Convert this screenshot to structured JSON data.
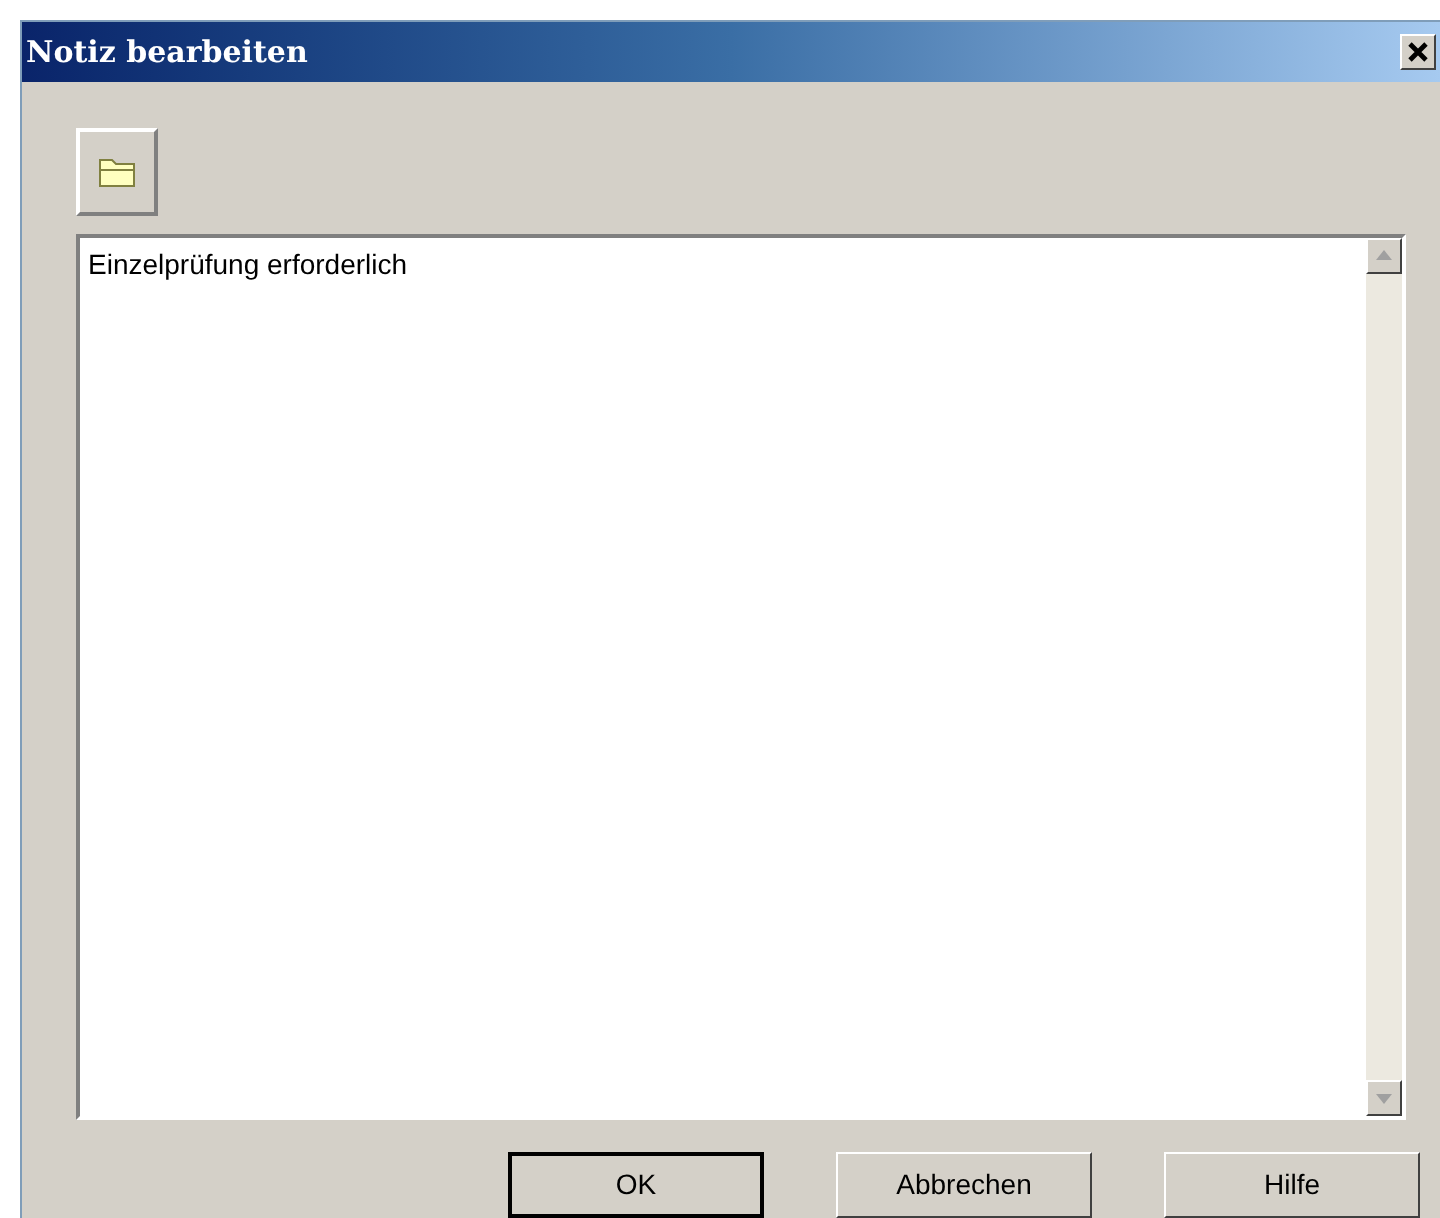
{
  "window": {
    "title": "Notiz bearbeiten"
  },
  "note": {
    "value": "Einzelprüfung erforderlich"
  },
  "buttons": [
    {
      "label": "OK",
      "default": true
    },
    {
      "label": "Abbrechen",
      "default": false
    },
    {
      "label": "Hilfe",
      "default": false
    }
  ]
}
